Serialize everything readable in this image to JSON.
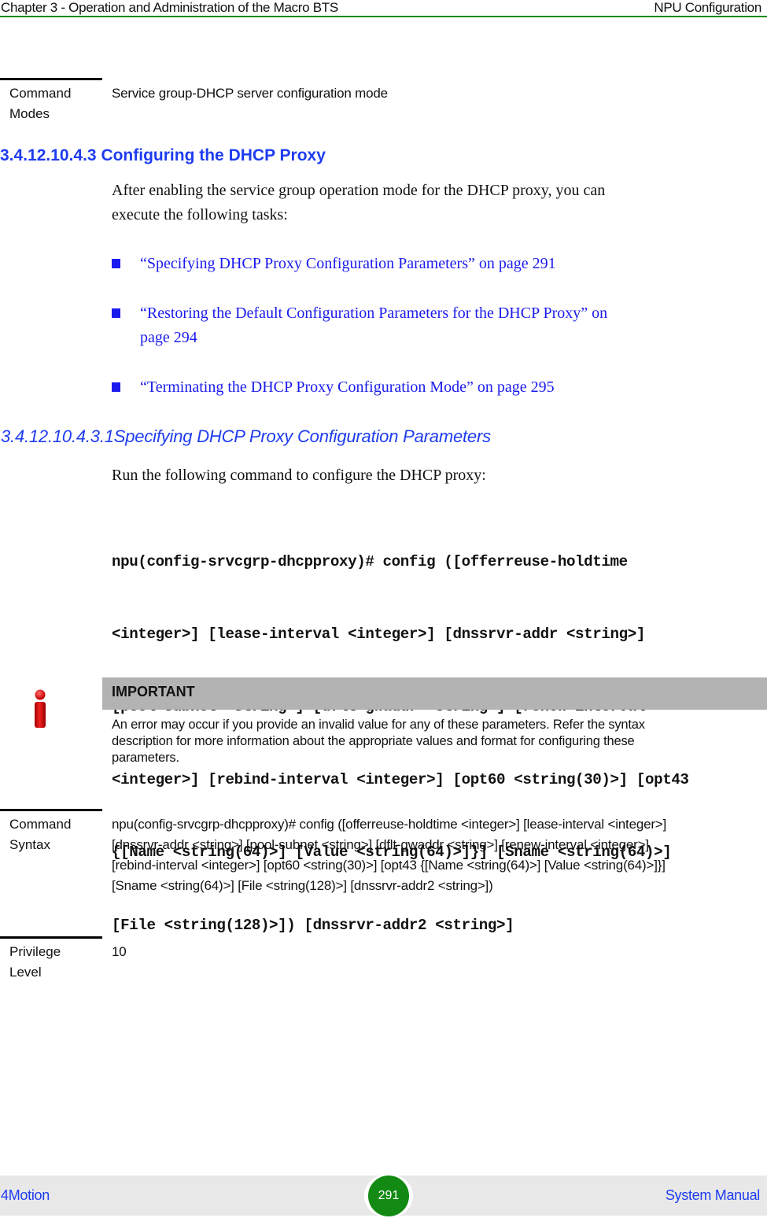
{
  "header": {
    "chapter": "Chapter 3 - Operation and Administration of the Macro BTS",
    "section": "NPU Configuration",
    "rule_color": "#1a8a1a"
  },
  "command_modes": {
    "label_line1": "Command",
    "label_line2": "Modes",
    "value": "Service group-DHCP server configuration mode"
  },
  "section": {
    "heading": "3.4.12.10.4.3 Configuring the DHCP Proxy",
    "intro_line1": "After enabling the service group operation mode for the DHCP proxy, you can",
    "intro_line2": "execute the following tasks:",
    "tasks": [
      {
        "line1": "“Specifying DHCP Proxy Configuration Parameters” on page 291",
        "line2": ""
      },
      {
        "line1": "“Restoring the Default Configuration Parameters for the DHCP Proxy” on",
        "line2": "page 294"
      },
      {
        "line1": "“Terminating the DHCP Proxy Configuration Mode” on page 295",
        "line2": ""
      }
    ]
  },
  "subsection": {
    "heading": "3.4.12.10.4.3.1Specifying DHCP Proxy Configuration Parameters",
    "intro": "Run the following command to configure the DHCP proxy:",
    "command_lines": [
      "npu(config-srvcgrp-dhcpproxy)# config ([offerreuse-holdtime",
      "<integer>] [lease-interval <integer>] [dnssrvr-addr <string>]",
      "[pool-subnet <string>] [dflt-gwaddr <string>] [renew-interval",
      "<integer>] [rebind-interval <integer>] [opt60 <string(30)>] [opt43",
      "{[Name <string(64)>] [Value <string(64)>]}] [Sname <string(64)>]",
      "[File <string(128)>]) [dnssrvr-addr2 <string>]"
    ]
  },
  "important": {
    "icon": "info-icon",
    "title": "IMPORTANT",
    "text_lines": [
      "An error may occur if you provide an invalid value for any of these parameters. Refer the syntax",
      "description for more information about the appropriate values and format for configuring these",
      "parameters."
    ]
  },
  "command_syntax": {
    "label_line1": "Command",
    "label_line2": "Syntax",
    "lines": [
      "npu(config-srvcgrp-dhcpproxy)# config ([offerreuse-holdtime <integer>] [lease-interval <integer>]",
      "[dnssrvr-addr <string>] [pool-subnet <string>] [dflt-gwaddr <string>] [renew-interval <integer>]",
      "[rebind-interval <integer>] [opt60 <string(30)>] [opt43 {[Name <string(64)>] [Value <string(64)>]}]",
      "[Sname <string(64)>] [File <string(128)>] [dnssrvr-addr2 <string>])"
    ]
  },
  "privilege_level": {
    "label_line1": "Privilege",
    "label_line2": "Level",
    "value": "10"
  },
  "footer": {
    "product": "4Motion",
    "page_number": "291",
    "manual": "System Manual",
    "badge_color": "#138a13"
  }
}
